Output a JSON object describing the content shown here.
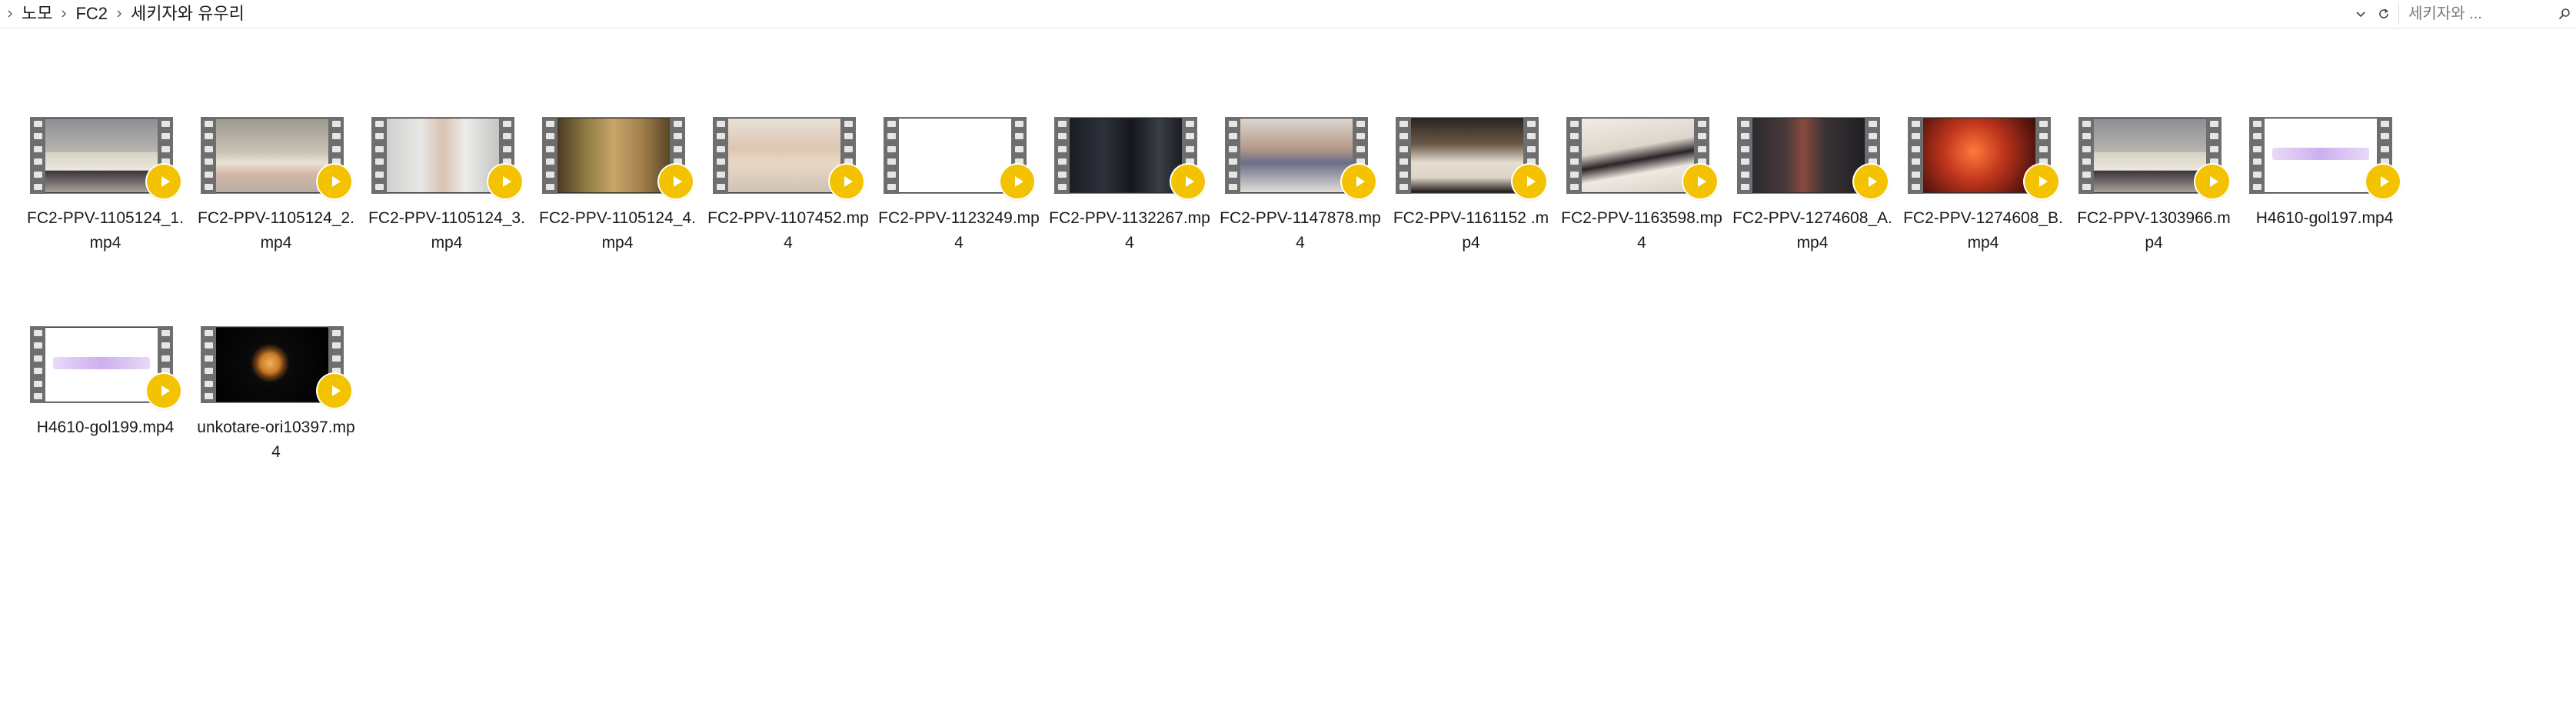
{
  "breadcrumb": {
    "items": [
      "노모",
      "FC2",
      "세키자와 유우리"
    ]
  },
  "search": {
    "placeholder": "세키자와 ..."
  },
  "icons": {
    "history_dropdown": "chevron-down-icon",
    "refresh": "refresh-icon",
    "search": "search-icon",
    "play": "play-icon"
  },
  "colors": {
    "play_badge": "#f3c200",
    "film_strip": "#6e6e6e"
  },
  "files": [
    {
      "name": "FC2-PPV-1105124_1.mp4",
      "thumb": "room-couch"
    },
    {
      "name": "FC2-PPV-1105124_2.mp4",
      "thumb": "room-couch-light"
    },
    {
      "name": "FC2-PPV-1105124_3.mp4",
      "thumb": "bathroom"
    },
    {
      "name": "FC2-PPV-1105124_4.mp4",
      "thumb": "warm-room"
    },
    {
      "name": "FC2-PPV-1107452.mp4",
      "thumb": "bright-room"
    },
    {
      "name": "FC2-PPV-1123249.mp4",
      "thumb": "blank-white"
    },
    {
      "name": "FC2-PPV-1132267.mp4",
      "thumb": "dark-legs"
    },
    {
      "name": "FC2-PPV-1147878.mp4",
      "thumb": "chair-legs"
    },
    {
      "name": "FC2-PPV-1161152 .mp4",
      "thumb": "two-people"
    },
    {
      "name": "FC2-PPV-1163598.mp4",
      "thumb": "bed-white"
    },
    {
      "name": "FC2-PPV-1274608_A.mp4",
      "thumb": "dark-interior"
    },
    {
      "name": "FC2-PPV-1274608_B.mp4",
      "thumb": "red-glow"
    },
    {
      "name": "FC2-PPV-1303966.mp4",
      "thumb": "room-couch"
    },
    {
      "name": "H4610-gol197.mp4",
      "thumb": "logo-white"
    },
    {
      "name": "H4610-gol199.mp4",
      "thumb": "logo-white"
    },
    {
      "name": "unkotare-ori10397.mp4",
      "thumb": "black-object"
    }
  ]
}
